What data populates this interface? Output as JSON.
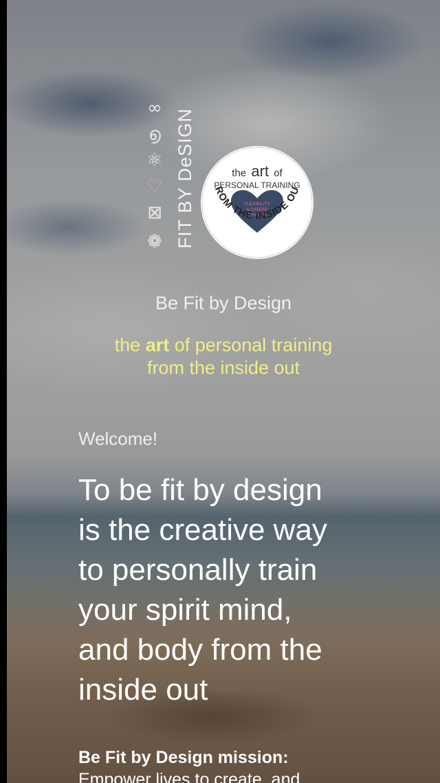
{
  "logo": {
    "brand_vertical": "FIT BY DeSIGN",
    "icons": [
      "infinity-icon",
      "spiral-icon",
      "atom-icon",
      "heart-swirl-icon",
      "square-geometry-icon",
      "flower-of-life-icon"
    ],
    "badge": {
      "line1_prefix": "the",
      "line1_art": "art",
      "line1_suffix": "of",
      "line2": "PERSONAL TRAINING",
      "heart_lines": [
        "FLEXIBILITY",
        "& CARDIO",
        "RHYTHM"
      ],
      "arc_text": "FROM THE INSIDE OUT"
    }
  },
  "site_title": "Be Fit by Design",
  "tagline": {
    "prefix": "the",
    "bold": "art",
    "rest": "of personal training",
    "line2": "from the inside out"
  },
  "welcome": "Welcome!",
  "headline_lines": [
    "To be fit by design",
    "is the creative way",
    "to personally train",
    "your spirit mind,",
    "and body from the",
    "inside out"
  ],
  "mission": {
    "title": "Be Fit by Design mission:",
    "text": "Empower lives to create, and"
  },
  "colors": {
    "tagline": "#f1ee86",
    "heart": "#3b4a66",
    "heart_text": "#e06b8a"
  }
}
